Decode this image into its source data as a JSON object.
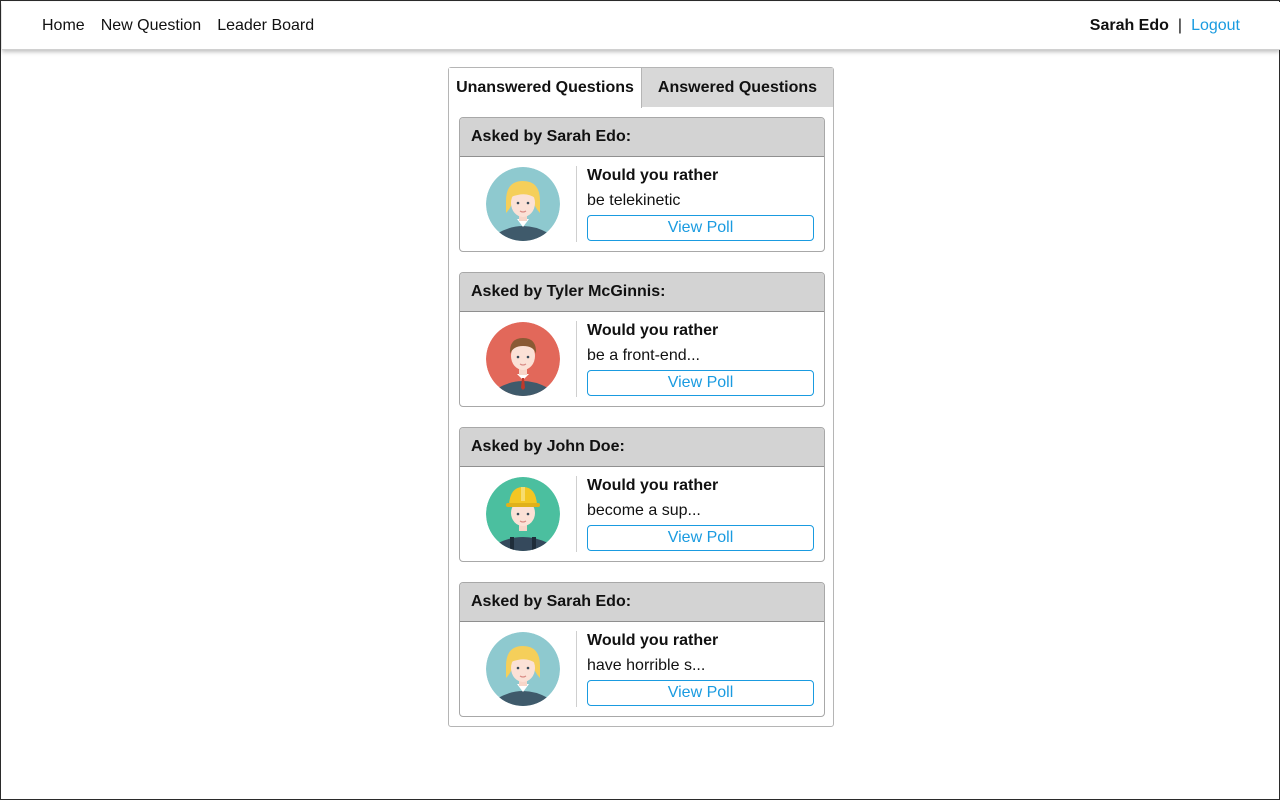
{
  "nav": {
    "links": [
      "Home",
      "New Question",
      "Leader Board"
    ],
    "user_name": "Sarah Edo",
    "separator": "|",
    "logout_label": "Logout",
    "logout_color": "#1a9be0"
  },
  "tabs": {
    "unanswered_label": "Unanswered Questions",
    "answered_label": "Answered Questions",
    "active": "unanswered"
  },
  "questions": [
    {
      "header": "Asked by Sarah Edo:",
      "title": "Would you rather",
      "text": "be telekinetic",
      "button_label": "View Poll",
      "avatar_icon": "woman-avatar-icon"
    },
    {
      "header": "Asked by Tyler McGinnis:",
      "title": "Would you rather",
      "text": "be a front-end...",
      "button_label": "View Poll",
      "avatar_icon": "man-avatar-icon"
    },
    {
      "header": "Asked by John Doe:",
      "title": "Would you rather",
      "text": "become a sup...",
      "button_label": "View Poll",
      "avatar_icon": "worker-avatar-icon"
    },
    {
      "header": "Asked by Sarah Edo:",
      "title": "Would you rather",
      "text": "have horrible s...",
      "button_label": "View Poll",
      "avatar_icon": "woman-avatar-icon"
    }
  ],
  "colors": {
    "accent": "#1a9be0",
    "header_bg": "#d3d3d3",
    "inactive_tab_bg": "#d8d8d8",
    "avatar_woman_bg": "#8ec9cf",
    "avatar_man_bg": "#e2685a",
    "avatar_worker_bg": "#4bbf9f"
  }
}
